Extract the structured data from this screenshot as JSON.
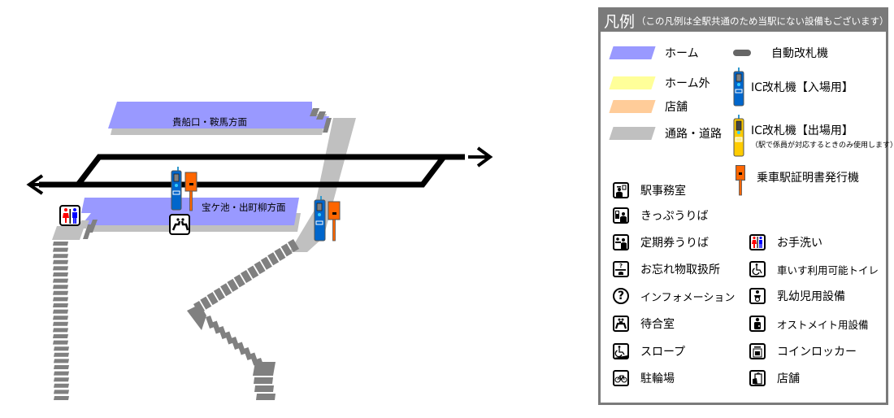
{
  "map": {
    "platforms": [
      {
        "label": "貴船口・鞍馬方面"
      },
      {
        "label": "宝ケ池・出町柳方面"
      }
    ],
    "colors": {
      "platform": "#9999ff",
      "outside_platform": "#ffff99",
      "shop": "#ffcc99",
      "passage": "#c0c0c0",
      "stairs": "#808080",
      "track": "#000000",
      "ic_gate_in": "#0066cc",
      "ic_gate_out": "#ffcc00",
      "certificate_machine": "#ff6600"
    }
  },
  "legend": {
    "title": "凡例",
    "note": "（この凡例は全駅共通のため当駅にない設備もございます）",
    "areas": [
      {
        "label": "ホーム",
        "color": "#9999ff"
      },
      {
        "label": "ホーム外",
        "color": "#ffff99"
      },
      {
        "label": "店舗",
        "color": "#ffcc99"
      },
      {
        "label": "通路・道路",
        "color": "#c0c0c0"
      }
    ],
    "machines": [
      {
        "label": "自動改札機",
        "icon": "auto-gate-icon"
      },
      {
        "label": "IC改札機【入場用】",
        "icon": "ic-gate-entry-icon"
      },
      {
        "label": "IC改札機【出場用】",
        "sub": "（駅で係員が対応するときのみ使用します）",
        "icon": "ic-gate-exit-icon"
      },
      {
        "label": "乗車駅証明書発行機",
        "icon": "certificate-machine-icon"
      }
    ],
    "facilities_left": [
      {
        "label": "駅事務室",
        "icon": "station-office-icon"
      },
      {
        "label": "きっぷうりば",
        "icon": "ticket-counter-icon"
      },
      {
        "label": "定期券うりば",
        "icon": "commuter-pass-counter-icon"
      },
      {
        "label": "お忘れ物取扱所",
        "icon": "lost-and-found-icon"
      },
      {
        "label": "インフォメーション",
        "icon": "information-icon"
      },
      {
        "label": "待合室",
        "icon": "waiting-room-icon"
      },
      {
        "label": "スロープ",
        "icon": "slope-icon"
      },
      {
        "label": "駐輪場",
        "icon": "bicycle-parking-icon"
      }
    ],
    "facilities_right": [
      {
        "label": "お手洗い",
        "icon": "restroom-icon"
      },
      {
        "label": "車いす利用可能トイレ",
        "icon": "wheelchair-toilet-icon"
      },
      {
        "label": "乳幼児用設備",
        "icon": "baby-facility-icon"
      },
      {
        "label": "オストメイト用設備",
        "icon": "ostomate-icon"
      },
      {
        "label": "コインロッカー",
        "icon": "coin-locker-icon"
      },
      {
        "label": "店舗",
        "icon": "shop-icon"
      }
    ]
  }
}
